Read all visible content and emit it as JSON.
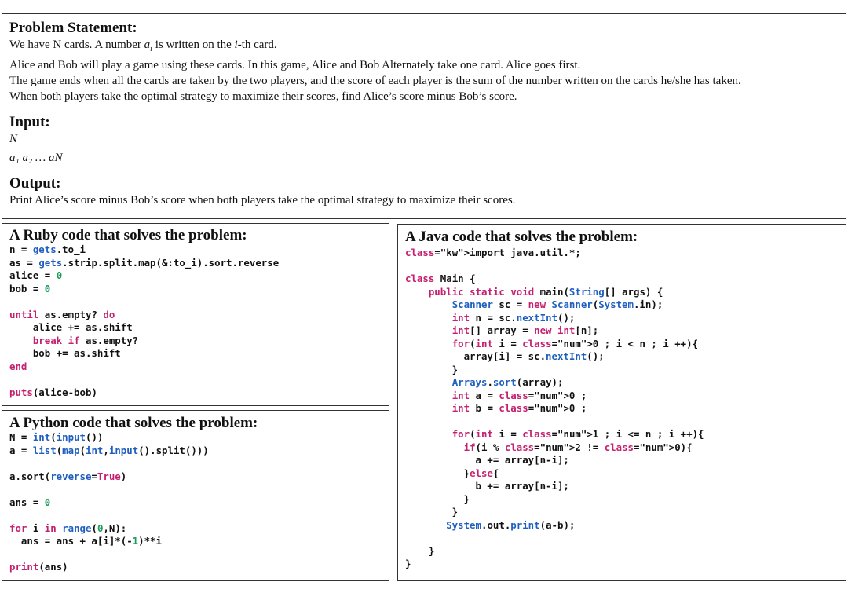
{
  "problem": {
    "title": "Problem Statement:",
    "line1_a": "We have N cards. A number ",
    "line1_var": "a",
    "line1_sub": "i",
    "line1_b": " is written on the ",
    "line1_i": "i",
    "line1_c": "-th card.",
    "line2": "Alice and Bob will play a game using these cards. In this game, Alice and Bob Alternately take one card. Alice goes first.",
    "line3": "The game ends when all the cards are taken by the two players, and the score of each player is the sum of the number written on the cards he/she has taken.",
    "line4": "When both players take the optimal strategy to maximize their scores, find Alice’s score minus Bob’s score.",
    "input_title": "Input:",
    "input_n": "N",
    "input_seq": "a₁ a₂ … aN",
    "output_title": "Output:",
    "output_text": "Print Alice’s score minus Bob’s score when both players take the optimal strategy to maximize their scores."
  },
  "ruby": {
    "title": "A Ruby code that solves the problem:",
    "lines": [
      "n = gets.to_i",
      "as = gets.strip.split.map(&:to_i).sort.reverse",
      "alice = 0",
      "bob = 0",
      "",
      "until as.empty? do",
      "    alice += as.shift",
      "    break if as.empty?",
      "    bob += as.shift",
      "end",
      "",
      "puts(alice-bob)"
    ]
  },
  "python": {
    "title": "A Python code that solves the problem:",
    "lines": [
      "N = int(input())",
      "a = list(map(int,input().split()))",
      "",
      "a.sort(reverse=True)",
      "",
      "ans = 0",
      "",
      "for i in range(0,N):",
      "  ans = ans + a[i]*(-1)**i",
      "",
      "print(ans)"
    ]
  },
  "java": {
    "title": "A Java code that solves the problem:",
    "lines": [
      "import java.util.*;",
      "",
      "class Main {",
      "    public static void main(String[] args) {",
      "        Scanner sc = new Scanner(System.in);",
      "        int n = sc.nextInt();",
      "        int[] array = new int[n];",
      "        for(int i = 0 ; i < n ; i ++){",
      "          array[i] = sc.nextInt();",
      "        }",
      "        Arrays.sort(array);",
      "        int a = 0 ;",
      "        int b = 0 ;",
      "",
      "        for(int i = 1 ; i <= n ; i ++){",
      "          if(i % 2 != 0){",
      "            a += array[n-i];",
      "          }else{",
      "            b += array[n-i];",
      "          }",
      "        }",
      "       System.out.print(a-b);",
      "",
      "    }",
      "}"
    ]
  }
}
